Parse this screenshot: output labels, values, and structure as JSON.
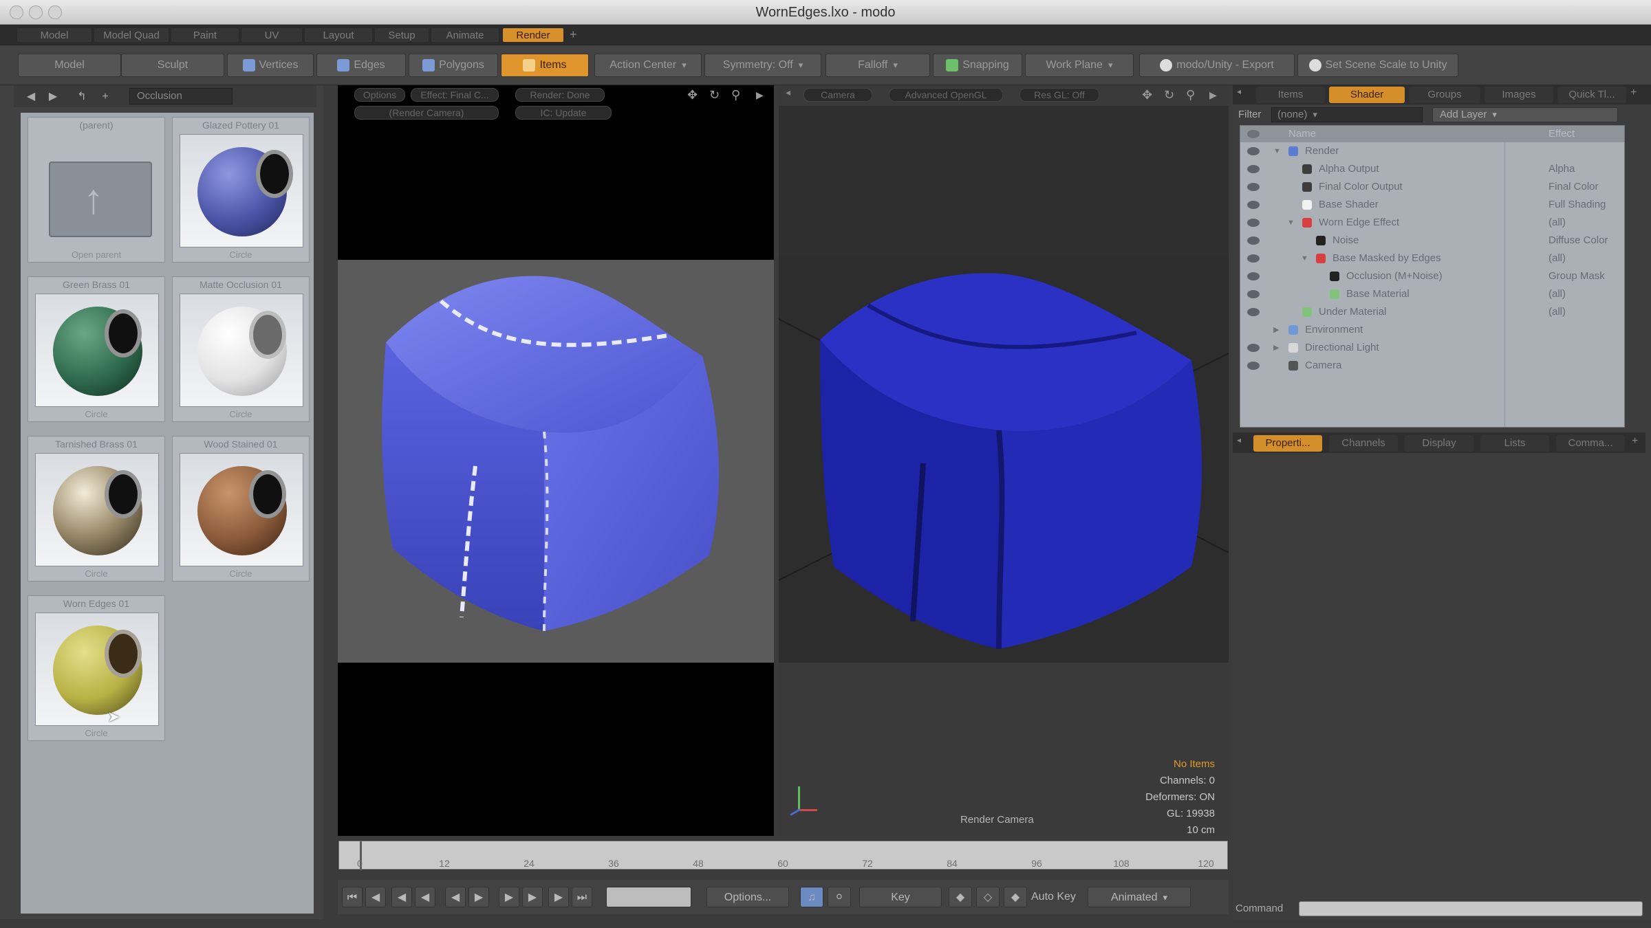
{
  "window": {
    "title": "WornEdges.lxo - modo"
  },
  "layout_tabs": [
    "Model",
    "Model Quad",
    "Paint",
    "UV",
    "Layout",
    "Setup",
    "Animate",
    "Render"
  ],
  "toolbar": {
    "model": "Model",
    "sculpt": "Sculpt",
    "vertices": "Vertices",
    "edges": "Edges",
    "polygons": "Polygons",
    "items": "Items",
    "action_center": "Action Center",
    "symmetry": "Symmetry: Off",
    "falloff": "Falloff",
    "snapping": "Snapping",
    "work_plane": "Work Plane",
    "modo_unity": "modo/Unity - Export",
    "scene_scale": "Set Scene Scale to Unity"
  },
  "presets": {
    "filter": "Occlusion",
    "items": [
      {
        "title": "(parent)",
        "label": "Open parent",
        "color": "#7d8389"
      },
      {
        "title": "Glazed Pottery 01",
        "label": "Circle",
        "color": "#4b55a8"
      },
      {
        "title": "Green Brass 01",
        "label": "Circle",
        "color": "#2f6a4e"
      },
      {
        "title": "Matte Occlusion 01",
        "label": "Circle",
        "color": "#e3e3e3"
      },
      {
        "title": "Tarnished Brass 01",
        "label": "Circle",
        "color": "#9a8a6a"
      },
      {
        "title": "Wood Stained 01",
        "label": "Circle",
        "color": "#8a5a3a"
      },
      {
        "title": "Worn Edges 01",
        "label": "Circle",
        "color": "#b7b145"
      }
    ]
  },
  "viewport_left": {
    "options": "Options",
    "effect": "Effect: Final C...",
    "render_done": "Render: Done",
    "camera": "(Render Camera)",
    "ic_update": "IC: Update"
  },
  "viewport_right": {
    "camera": "Camera",
    "advanced": "Advanced OpenGL",
    "res": "Res GL: Off",
    "info": {
      "items": "No Items",
      "channels": "Channels: 0",
      "deformers": "Deformers: ON",
      "gl": "GL: 19938",
      "scale": "10 cm"
    },
    "cam_label": "Render Camera"
  },
  "timeline": {
    "ticks": [
      "0",
      "12",
      "24",
      "36",
      "48",
      "60",
      "72",
      "84",
      "96",
      "108",
      "120"
    ]
  },
  "playbar": {
    "options": "Options...",
    "key": "Key",
    "auto_key": "Auto Key",
    "animated": "Animated"
  },
  "right_tabs": [
    "Items",
    "Shader",
    "Groups",
    "Images",
    "Quick Tl..."
  ],
  "shader": {
    "filter_label": "Filter",
    "filter_value": "(none)",
    "add_layer": "Add Layer",
    "col_name": "Name",
    "col_effect": "Effect",
    "rows": [
      {
        "name": "Render",
        "effect": "",
        "color": "#5a7bd0"
      },
      {
        "name": "Alpha Output",
        "effect": "Alpha",
        "color": "#3d3d3d"
      },
      {
        "name": "Final Color Output",
        "effect": "Final Color",
        "color": "#3d3d3d"
      },
      {
        "name": "Base Shader",
        "effect": "Full Shading",
        "color": "#f2f2f2"
      },
      {
        "name": "Worn Edge Effect",
        "effect": "(all)",
        "color": "#d84040"
      },
      {
        "name": "Noise",
        "effect": "Diffuse Color",
        "color": "#222222"
      },
      {
        "name": "Base Masked by Edges",
        "effect": "(all)",
        "color": "#d84040"
      },
      {
        "name": "Occlusion (M+Noise)",
        "effect": "Group Mask",
        "color": "#222222"
      },
      {
        "name": "Base Material",
        "effect": "(all)",
        "color": "#7fc47a"
      },
      {
        "name": "Under Material",
        "effect": "(all)",
        "color": "#7fc47a"
      },
      {
        "name": "Environment",
        "effect": "",
        "color": "#6f9ad6"
      },
      {
        "name": "Directional Light",
        "effect": "",
        "color": "#d8d8d8"
      },
      {
        "name": "Camera",
        "effect": "",
        "color": "#555555"
      }
    ]
  },
  "props_tabs": [
    "Properti...",
    "Channels",
    "Display",
    "Lists",
    "Comma..."
  ],
  "command": {
    "label": "Command"
  }
}
